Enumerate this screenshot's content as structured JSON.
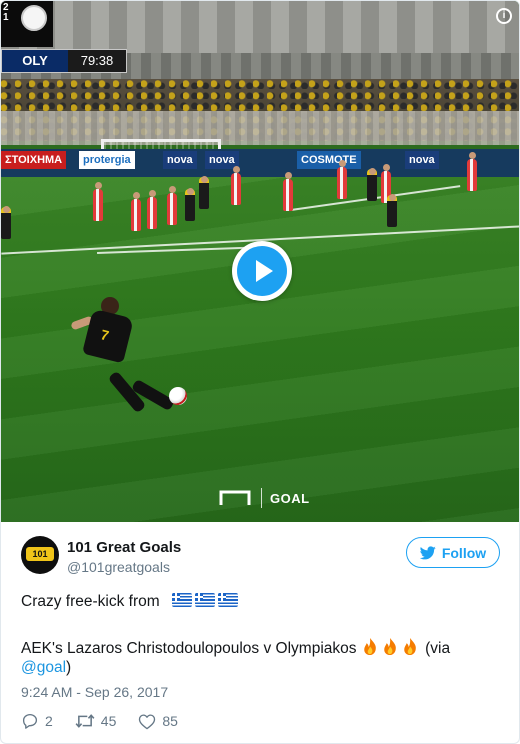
{
  "video": {
    "scoreboard": {
      "score_digits": "2\n1",
      "team": "OLY",
      "clock": "79:38"
    },
    "ads": [
      "ΣΤΟΙΧΗΜΑ",
      "protergia",
      "nova",
      "nova",
      "COSMOTE",
      "nova"
    ],
    "kicker_number": "7",
    "watermark": "GOAL",
    "info_label": "i",
    "play_icon": "play-icon"
  },
  "tweet": {
    "author_name": "101 Great Goals",
    "author_handle": "@101greatgoals",
    "avatar_text": "101",
    "follow_label": "Follow",
    "line1": "Crazy free-kick from",
    "line2_pre": "AEK's Lazaros Christodoulopoulos v Olympiakos",
    "line2_post": "(via",
    "line3_link": "@goal",
    "line3_post": ")",
    "timestamp": "9:24 AM - Sep 26, 2017",
    "replies": "2",
    "retweets": "45",
    "likes": "85"
  },
  "colors": {
    "accent": "#1da1f2",
    "link": "#1b95e0",
    "muted": "#657786",
    "text": "#14171a"
  }
}
